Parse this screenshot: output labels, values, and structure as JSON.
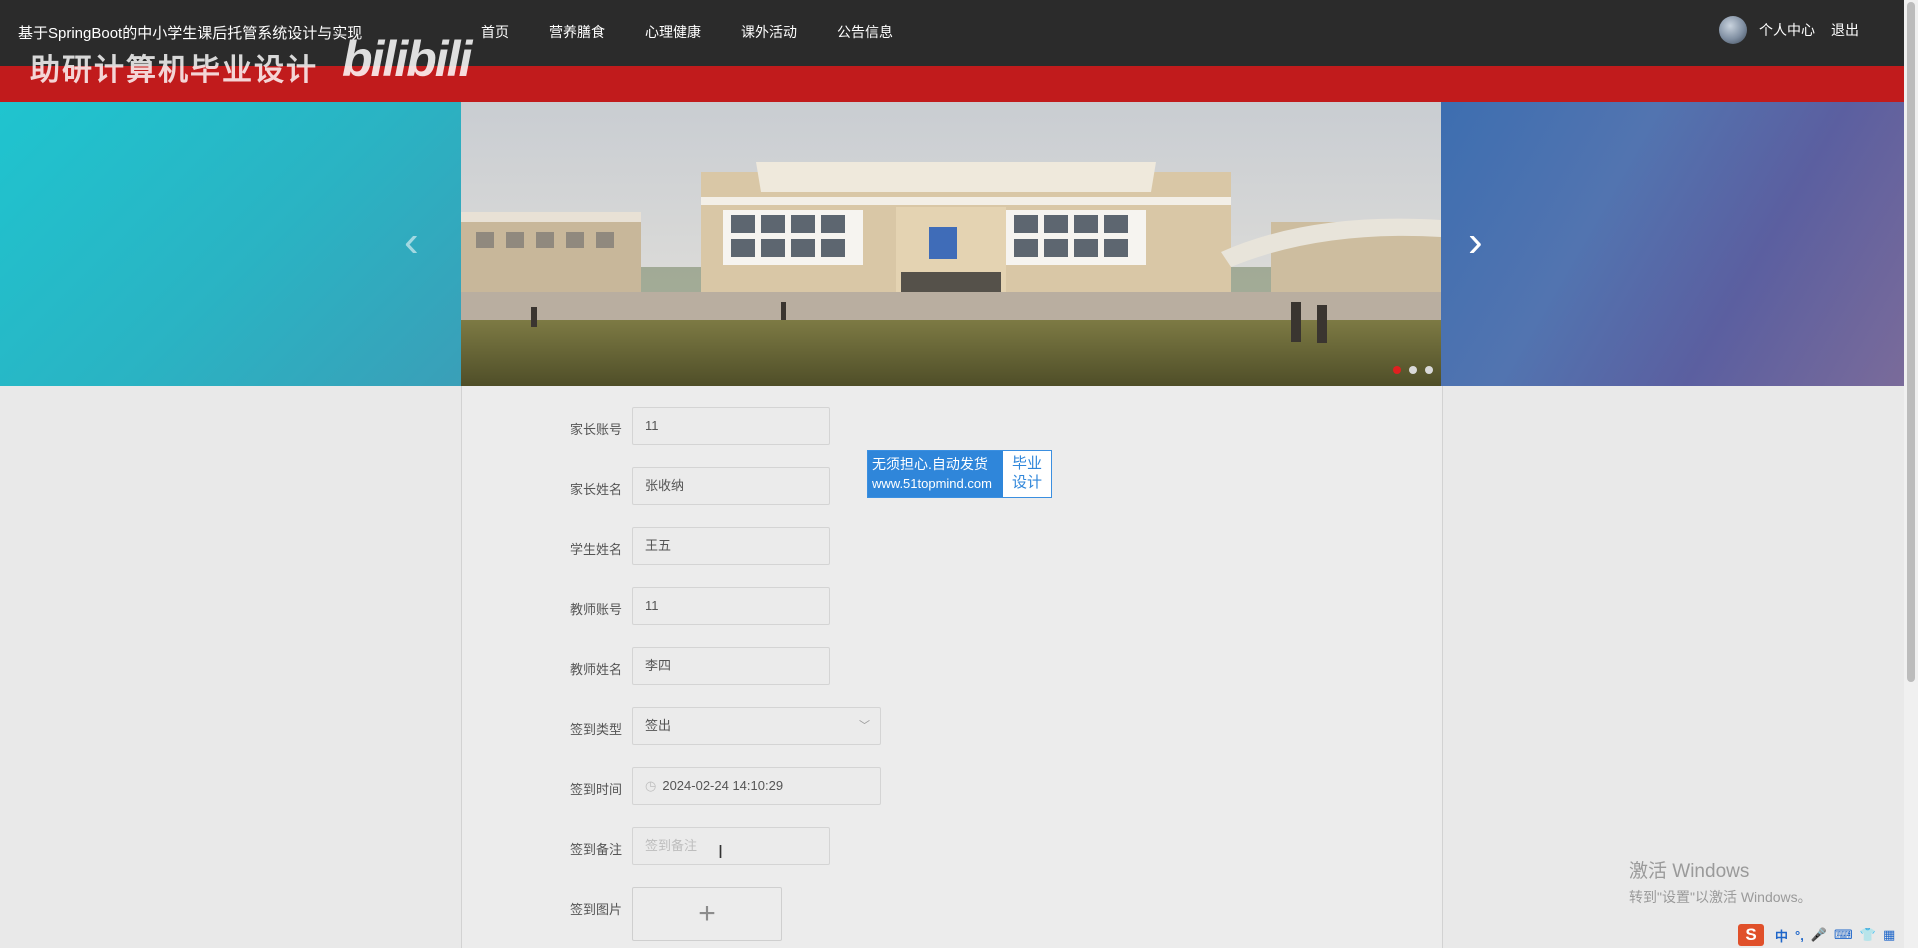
{
  "header": {
    "site_title": "基于SpringBoot的中小学生课后托管系统设计与实现",
    "nav": [
      "首页",
      "营养膳食",
      "心理健康",
      "课外活动",
      "公告信息"
    ],
    "user_center": "个人中心",
    "logout": "退出"
  },
  "watermark": {
    "cn": "助研计算机毕业设计",
    "bili": "bilibili"
  },
  "carousel": {
    "prev_glyph": "‹",
    "next_glyph": "›",
    "slide_count": 3,
    "active_index": 0
  },
  "form": {
    "fields": [
      {
        "label": "家长账号",
        "value": "11"
      },
      {
        "label": "家长姓名",
        "value": "张收纳"
      },
      {
        "label": "学生姓名",
        "value": "王五"
      },
      {
        "label": "教师账号",
        "value": "11"
      },
      {
        "label": "教师姓名",
        "value": "李四"
      },
      {
        "label": "签到类型",
        "value": "签出"
      },
      {
        "label": "签到时间",
        "value": "2024-02-24 14:10:29"
      },
      {
        "label": "签到备注",
        "placeholder": "签到备注"
      },
      {
        "label": "签到图片",
        "upload_glyph": "+"
      }
    ]
  },
  "ad": {
    "line1": "无须担心.自动发货",
    "line2": "www.51topmind.com",
    "right1": "毕业",
    "right2": "设计"
  },
  "windows_notice": {
    "title": "激活 Windows",
    "subtitle": "转到\"设置\"以激活 Windows。"
  },
  "ime": {
    "logo": "S",
    "items": [
      "中",
      "°,",
      "🎤",
      "⌨",
      "👕",
      "▦"
    ]
  },
  "colors": {
    "topbar": "#2b2b2b",
    "redband": "#c11b1c",
    "accent": "#2f86da",
    "active_dot": "#e02020"
  }
}
